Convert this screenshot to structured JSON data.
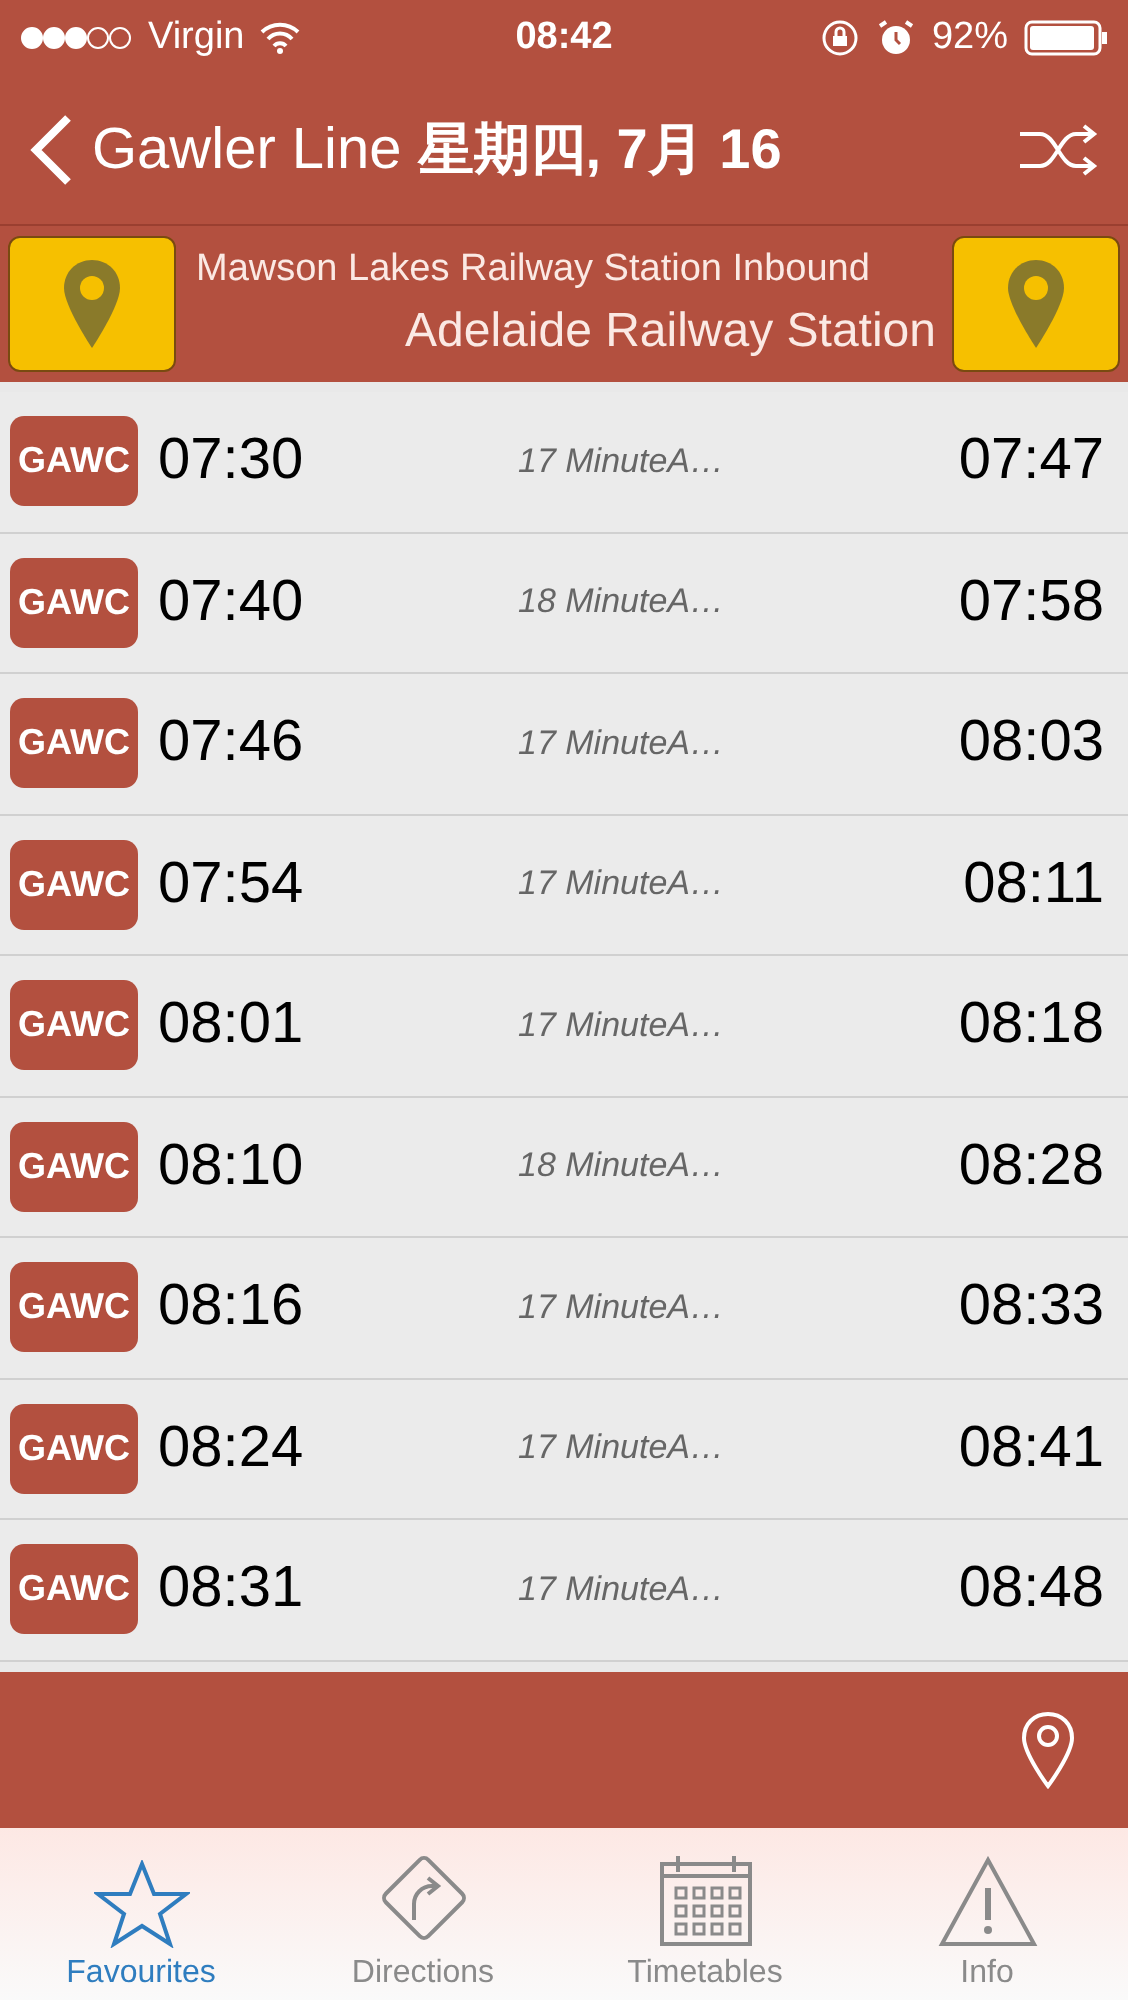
{
  "status_bar": {
    "carrier": "Virgin",
    "time": "08:42",
    "battery": "92%"
  },
  "nav": {
    "title": "Gawler Line",
    "date": "星期四, 7月 16"
  },
  "route": {
    "from": "Mawson Lakes Railway Station Inbound",
    "to": "Adelaide Railway Station"
  },
  "trips": [
    {
      "code": "GAWC",
      "depart": "07:30",
      "duration": "17 MinuteA…",
      "arrive": "07:47"
    },
    {
      "code": "GAWC",
      "depart": "07:40",
      "duration": "18 MinuteA…",
      "arrive": "07:58"
    },
    {
      "code": "GAWC",
      "depart": "07:46",
      "duration": "17 MinuteA…",
      "arrive": "08:03"
    },
    {
      "code": "GAWC",
      "depart": "07:54",
      "duration": "17 MinuteA…",
      "arrive": "08:11"
    },
    {
      "code": "GAWC",
      "depart": "08:01",
      "duration": "17 MinuteA…",
      "arrive": "08:18"
    },
    {
      "code": "GAWC",
      "depart": "08:10",
      "duration": "18 MinuteA…",
      "arrive": "08:28"
    },
    {
      "code": "GAWC",
      "depart": "08:16",
      "duration": "17 MinuteA…",
      "arrive": "08:33"
    },
    {
      "code": "GAWC",
      "depart": "08:24",
      "duration": "17 MinuteA…",
      "arrive": "08:41"
    },
    {
      "code": "GAWC",
      "depart": "08:31",
      "duration": "17 MinuteA…",
      "arrive": "08:48"
    }
  ],
  "tabs": [
    {
      "kind": "star",
      "label": "Favourites",
      "selected": true
    },
    {
      "kind": "directions",
      "label": "Directions",
      "selected": false
    },
    {
      "kind": "calendar",
      "label": "Timetables",
      "selected": false
    },
    {
      "kind": "warning",
      "label": "Info",
      "selected": false
    }
  ]
}
